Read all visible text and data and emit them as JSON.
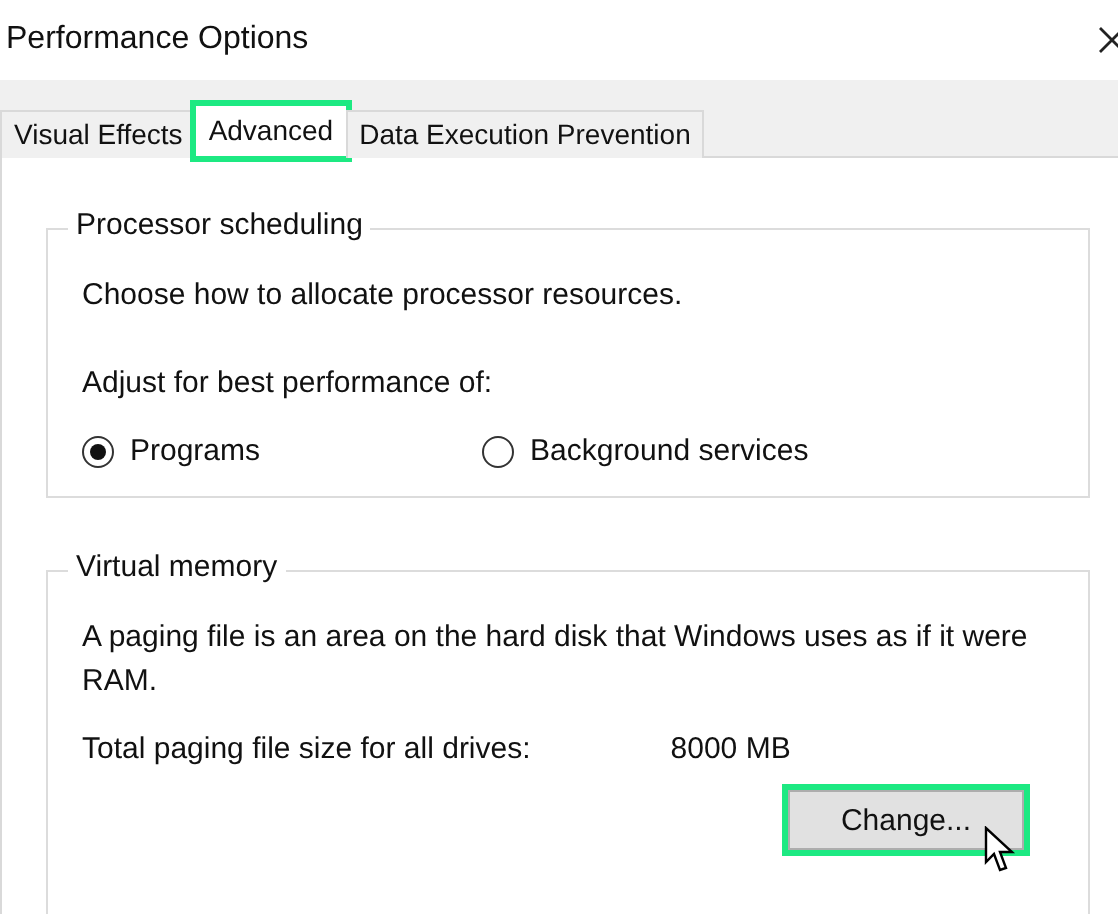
{
  "window": {
    "title": "Performance Options"
  },
  "tabs": [
    {
      "label": "Visual Effects",
      "selected": false,
      "highlighted": false
    },
    {
      "label": "Advanced",
      "selected": true,
      "highlighted": true
    },
    {
      "label": "Data Execution Prevention",
      "selected": false,
      "highlighted": false
    }
  ],
  "processor_scheduling": {
    "title": "Processor scheduling",
    "description": "Choose how to allocate processor resources.",
    "prompt": "Adjust for best performance of:",
    "options": [
      {
        "label": "Programs",
        "selected": true
      },
      {
        "label": "Background services",
        "selected": false
      }
    ]
  },
  "virtual_memory": {
    "title": "Virtual memory",
    "description": "A paging file is an area on the hard disk that Windows uses as if it were RAM.",
    "total_label": "Total paging file size for all drives:",
    "total_value": "8000 MB",
    "button": {
      "label": "Change...",
      "highlighted": true
    }
  }
}
